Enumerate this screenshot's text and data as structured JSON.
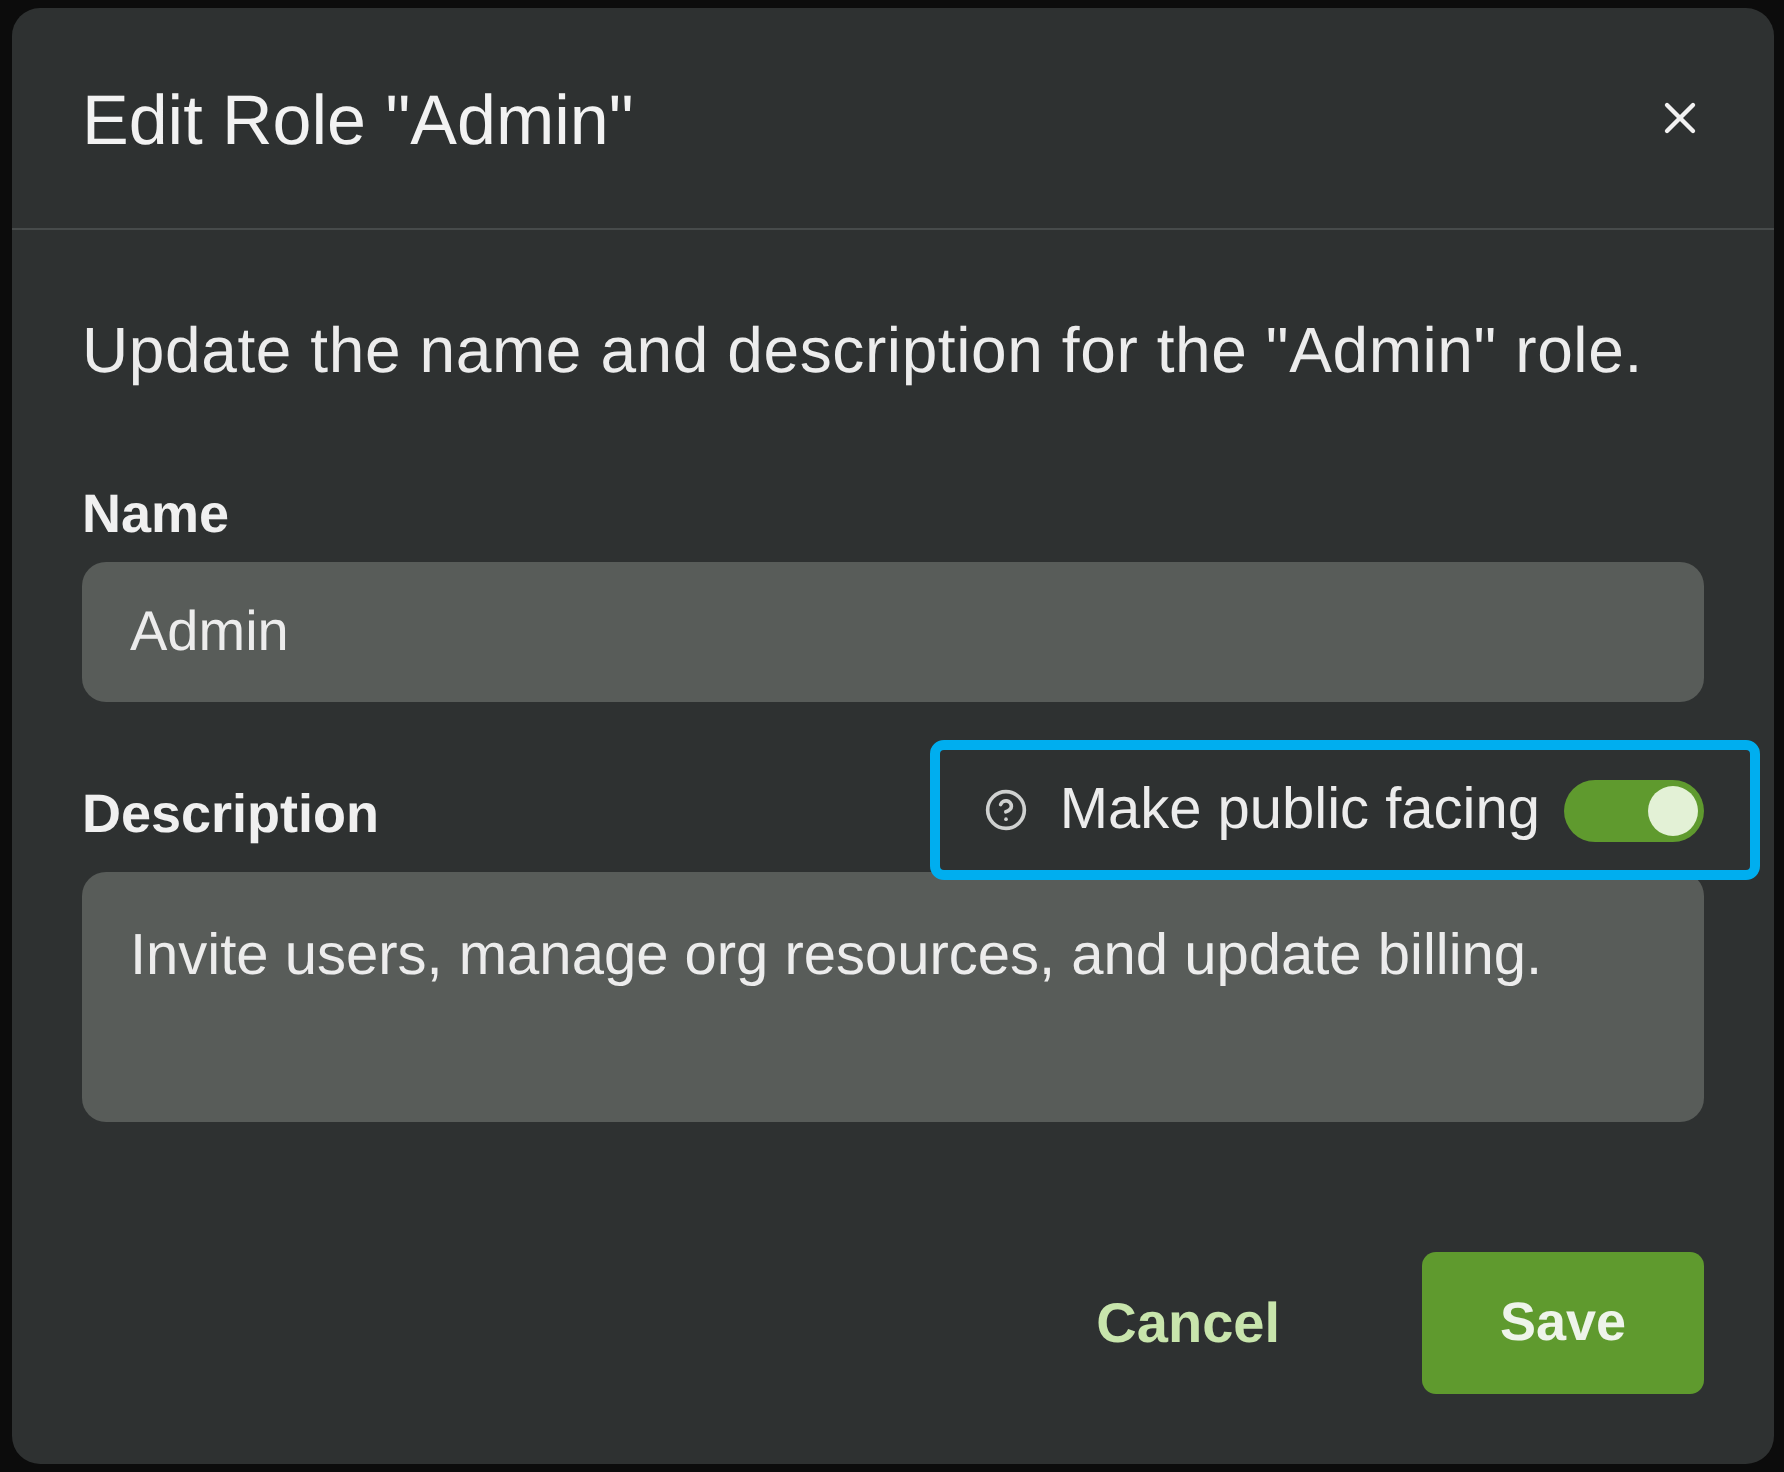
{
  "dialog": {
    "title": "Edit Role \"Admin\"",
    "description": "Update the name and description for the \"Admin\" role.",
    "fields": [
      {
        "kind": "input",
        "label": "Name",
        "value": "Admin"
      },
      {
        "kind": "textarea",
        "label": "Description",
        "value": "Invite users, manage org resources, and update billing.",
        "toggle": {
          "label": "Make public facing",
          "on": true,
          "highlighted": true
        }
      }
    ],
    "buttons": [
      {
        "kind": "secondary",
        "label": "Cancel"
      },
      {
        "kind": "primary",
        "label": "Save"
      }
    ]
  }
}
